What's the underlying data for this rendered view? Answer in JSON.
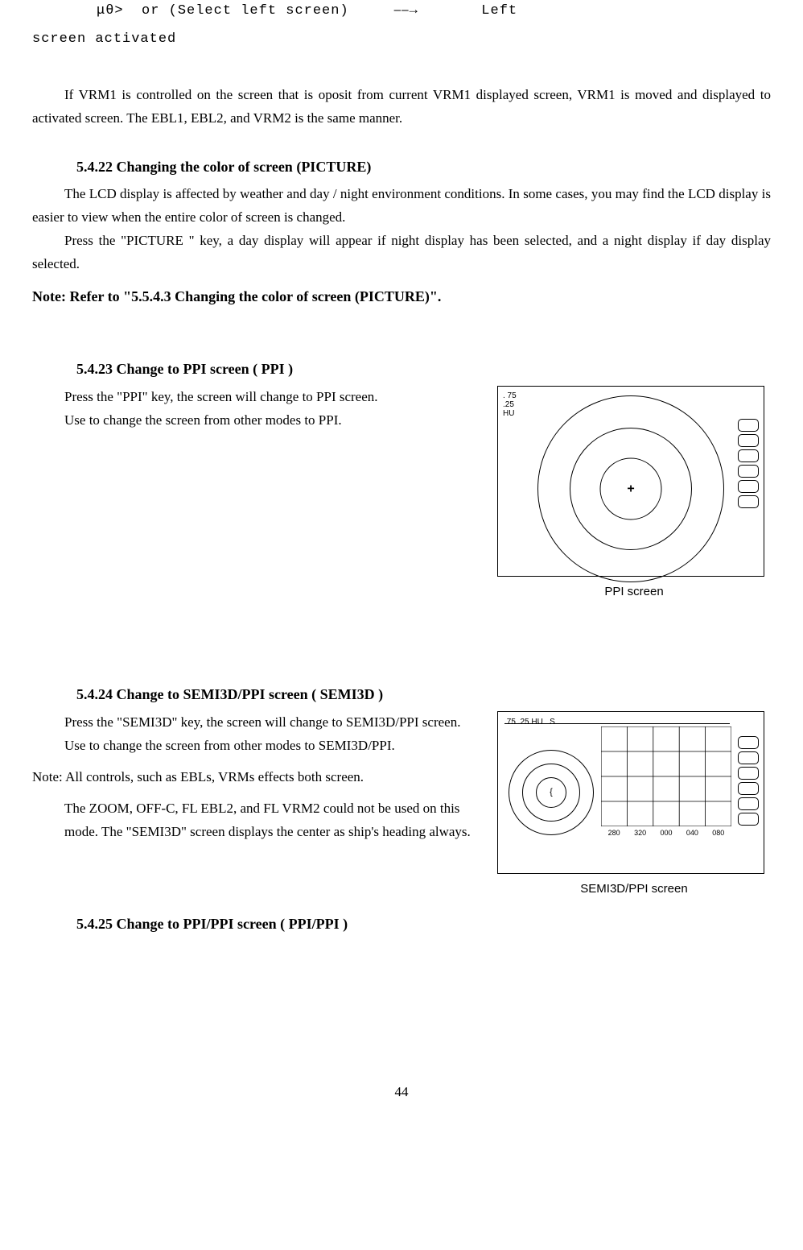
{
  "topline": {
    "prompt": "μθ>",
    "select": "or (Select left screen)",
    "arrow": "⎯⎯→",
    "result": "Left"
  },
  "topline2": "screen activated",
  "para_vrm": "If VRM1 is controlled on the screen that is oposit from current VRM1 displayed screen, VRM1 is moved and displayed to activated screen.  The EBL1, EBL2, and VRM2 is the same manner.",
  "s22": {
    "heading": "5.4.22 Changing the color of screen (PICTURE)",
    "p1": "The LCD display is affected by weather and day / night environment conditions. In some cases, you may find the LCD display is easier to view when the entire color of screen is changed.",
    "p2": "Press the \"PICTURE \" key, a day display will appear if night display has been selected, and a night  display if day display selected.",
    "note": "Note: Refer to \"5.5.4.3 Changing the color of screen (PICTURE)\"."
  },
  "s23": {
    "heading": "5.4.23 Change to PPI screen ( PPI )",
    "p1": "Press the \"PPI\" key,  the screen will change to PPI screen.",
    "p2": "Use to change the screen from other modes to PPI."
  },
  "s24": {
    "heading": "5.4.24 Change to SEMI3D/PPI screen ( SEMI3D )",
    "p1": "Press the \"SEMI3D\" key,  the screen will change to SEMI3D/PPI screen.",
    "p2": "Use to change the screen from other modes to SEMI3D/PPI.",
    "note1": "Note: All controls, such as EBLs, VRMs effects both screen.",
    "note2": "The ZOOM, OFF-C, FL EBL2, and FL VRM2 could not  be used on this mode. The \"SEMI3D\" screen displays the center as ship's heading always."
  },
  "s25": {
    "heading": "5.4.25 Change to PPI/PPI screen ( PPI/PPI )"
  },
  "fig1": {
    "line1": ". 75",
    "line2": ".25",
    "line3": "HU",
    "center": "+",
    "caption": "PPI screen"
  },
  "fig2": {
    "header_range": ".75 .25 HU",
    "header_s": "S",
    "center": "{",
    "grid_labels": [
      "280",
      "320",
      "000",
      "040",
      "080"
    ],
    "caption": "SEMI3D/PPI screen"
  },
  "page_number": "44"
}
